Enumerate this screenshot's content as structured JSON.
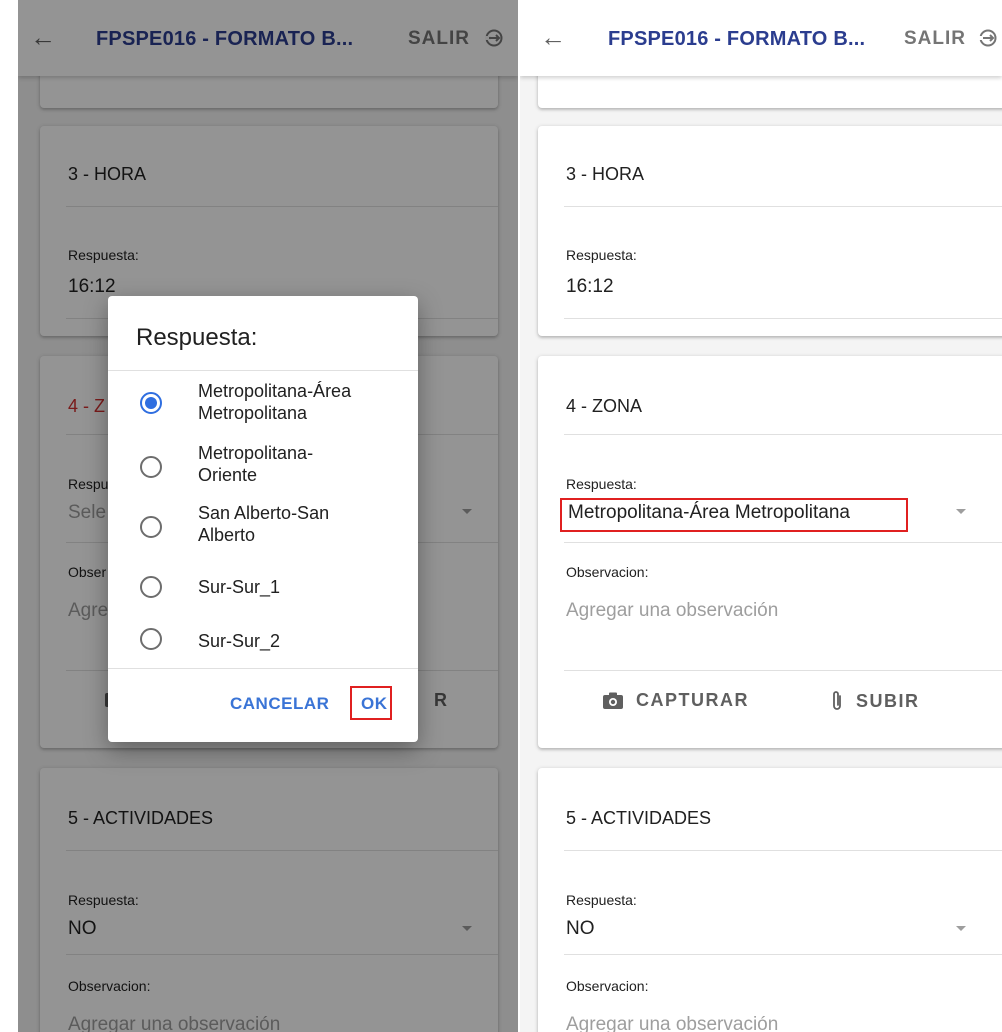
{
  "header": {
    "title": "FPSPE016 - FORMATO B...",
    "exit_label": "SALIR"
  },
  "questions": {
    "q3": {
      "title": "3 - HORA",
      "response_label": "Respuesta:",
      "value": "16:12"
    },
    "q4": {
      "title": "4 - ZONA",
      "title_short": "4 - Z",
      "response_label": "Respuesta:",
      "response_label_short": "Respu",
      "placeholder_short": "Sele",
      "value": "Metropolitana-Área Metropolitana",
      "observation_label": "Observacion:",
      "observation_label_short": "Obser",
      "observation_placeholder": "Agregar una observación",
      "observation_placeholder_short": "Agre",
      "capture_label": "CAPTURAR",
      "upload_label": "SUBIR",
      "upload_label_short": "R"
    },
    "q5": {
      "title": "5 - ACTIVIDADES",
      "response_label": "Respuesta:",
      "value": "NO",
      "observation_label": "Observacion:",
      "observation_placeholder": "Agregar una observación"
    }
  },
  "dialog": {
    "title": "Respuesta:",
    "options": [
      {
        "label": "Metropolitana-Área Metropolitana",
        "selected": true
      },
      {
        "label": "Metropolitana-Oriente",
        "selected": false
      },
      {
        "label": "San Alberto-San Alberto",
        "selected": false
      },
      {
        "label": "Sur-Sur_1",
        "selected": false
      },
      {
        "label": "Sur-Sur_2",
        "selected": false
      }
    ],
    "cancel_label": "CANCELAR",
    "ok_label": "OK"
  },
  "colors": {
    "title_blue": "#2b3d8f",
    "accent_blue": "#2f6ee0",
    "invalid_red": "#d32f2f",
    "highlight_red": "#e02020"
  },
  "icons": [
    "back-arrow-icon",
    "logout-icon",
    "camera-icon",
    "paperclip-icon",
    "dropdown-caret-icon"
  ]
}
